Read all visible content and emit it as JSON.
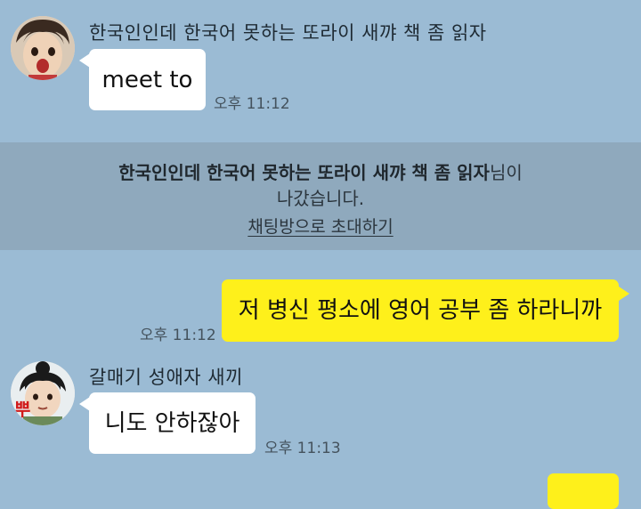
{
  "messages": [
    {
      "sender": "한국인인데 한국어 못하는 또라이 새꺄 책 좀 읽자",
      "text": "meet to",
      "time": "오후 11:12",
      "avatar_icon": "profile-photo-icon"
    },
    {
      "text": "저 병신 평소에 영어 공부 좀 하라니까",
      "time": "오후 11:12"
    },
    {
      "sender": "갈매기 성애자 새끼",
      "text": "니도 안하잖아",
      "time": "오후 11:13",
      "avatar_icon": "profile-photo-icon",
      "avatar_badge": "뿌"
    }
  ],
  "notice": {
    "user": "한국인인데 한국어 못하는 또라이 새꺄 책 좀 읽자",
    "suffix": "님이",
    "line2": "나갔습니다.",
    "invite": "채팅방으로 초대하기"
  },
  "colors": {
    "background": "#9bbbd4",
    "notice_band": "#8fa9bd",
    "my_bubble": "#fef01b",
    "their_bubble": "#ffffff"
  }
}
